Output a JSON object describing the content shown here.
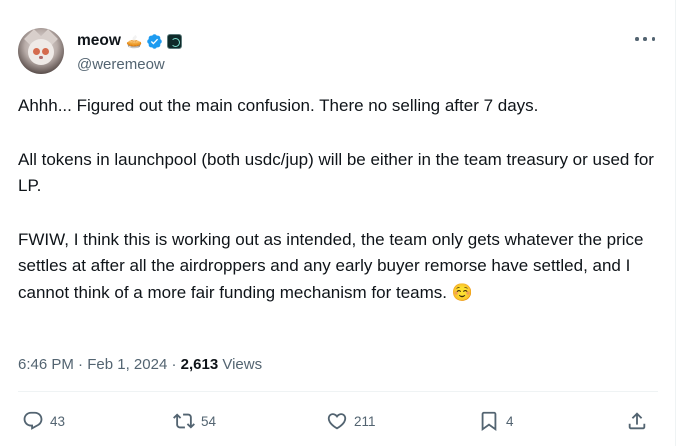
{
  "tweet": {
    "display_name": "meow",
    "handle": "@weremeow",
    "emoji": "🥧",
    "paragraphs": [
      "Ahhh... Figured out the main confusion. There no selling after 7 days.",
      "All tokens in launchpool (both usdc/jup) will be either in the team treasury or used for LP.",
      "FWIW, I think this is working out as intended, the team only gets whatever the price settles at after all the airdroppers and any early buyer remorse have settled, and I cannot think of a more fair funding mechanism for teams. ☺️"
    ],
    "time": "6:46 PM",
    "separator": "·",
    "date": "Feb 1, 2024",
    "views_count": "2,613",
    "views_label": "Views"
  },
  "actions": {
    "replies": "43",
    "reposts": "54",
    "likes": "211",
    "bookmarks": "4"
  },
  "colors": {
    "verified": "#1d9bf0",
    "text": "#0f1419",
    "secondary": "#536471",
    "divider": "#eff3f4"
  },
  "icons": [
    "verified-badge-icon",
    "affiliate-badge-icon",
    "more-icon",
    "reply-icon",
    "repost-icon",
    "like-icon",
    "bookmark-icon",
    "share-icon"
  ]
}
